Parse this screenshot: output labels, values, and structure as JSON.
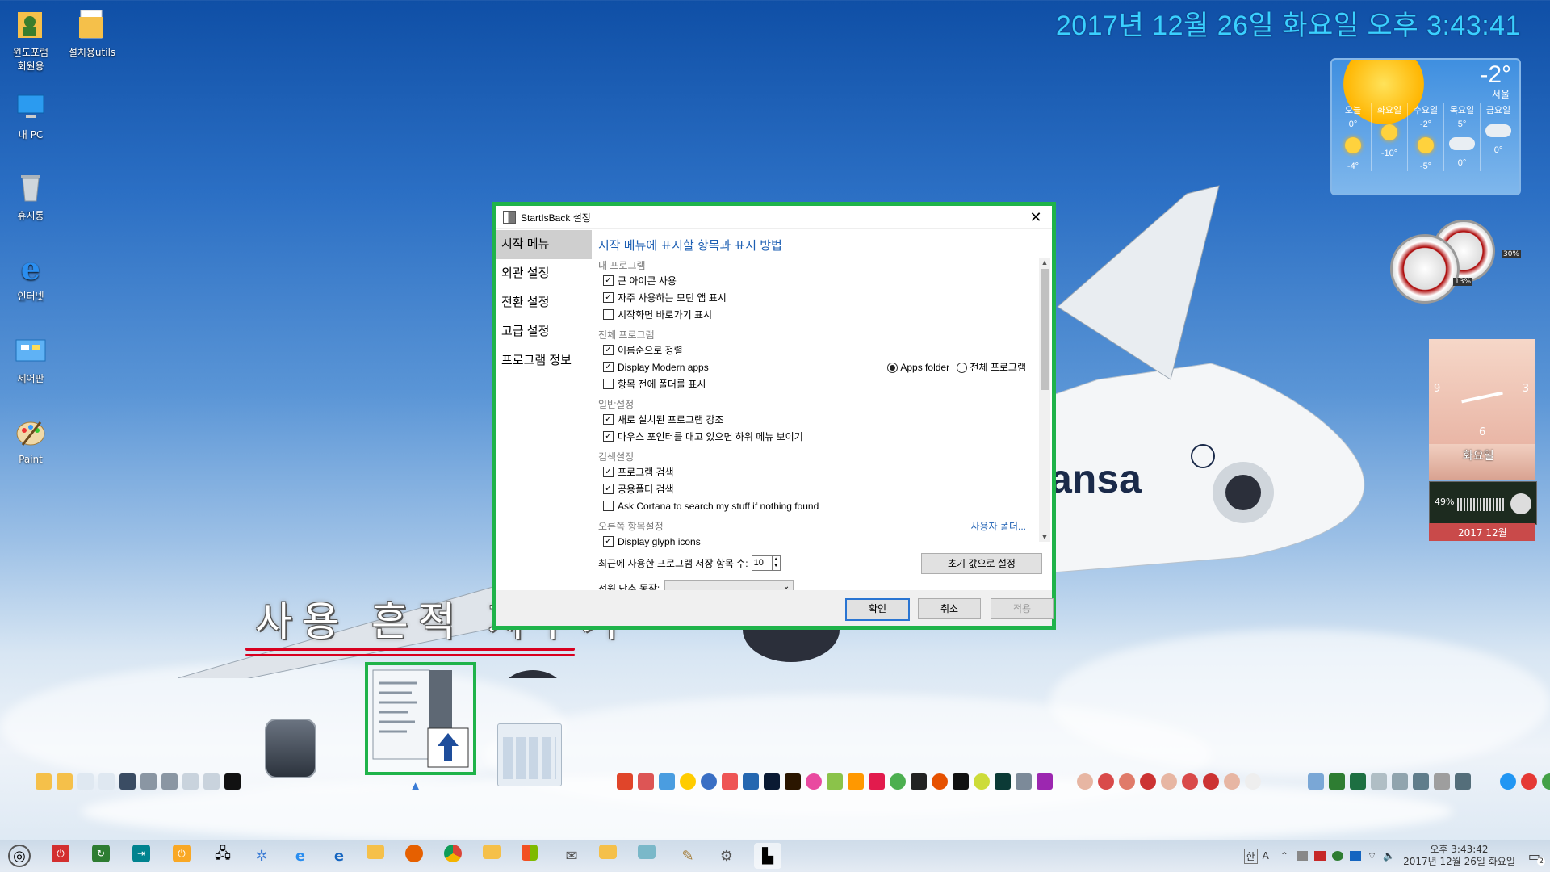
{
  "desktop": {
    "icons": [
      {
        "label1": "윈도포럼",
        "label2": "회원용"
      },
      {
        "label1": "설치용utils",
        "label2": ""
      },
      {
        "label1": "내 PC",
        "label2": ""
      },
      {
        "label1": "휴지통",
        "label2": ""
      },
      {
        "label1": "인터넷",
        "label2": ""
      },
      {
        "label1": "제어판",
        "label2": ""
      },
      {
        "label1": "Paint",
        "label2": ""
      }
    ],
    "clock_text": "2017년 12월 26일 화요일 오후 3:43:41",
    "caption": "사용 흔적 지우기"
  },
  "weather": {
    "temp": "-2°",
    "city": "서울",
    "days": [
      {
        "day": "오늘",
        "hi": "0°",
        "lo": "-4°",
        "icon": "sun"
      },
      {
        "day": "화요일",
        "hi": "",
        "lo": "-10°",
        "icon": "sun"
      },
      {
        "day": "수요일",
        "hi": "-2°",
        "lo": "-5°",
        "icon": "sun"
      },
      {
        "day": "목요일",
        "hi": "5°",
        "lo": "0°",
        "icon": "cloud"
      },
      {
        "day": "금요일",
        "hi": "",
        "lo": "0°",
        "icon": "cloud"
      }
    ]
  },
  "gadgets": {
    "cpu": "13%",
    "mem": "30%",
    "calendar_day": "화요일",
    "volume": "49%",
    "date_small": "2017 12월",
    "clock_digits": [
      "9",
      "3",
      "6"
    ]
  },
  "dialog": {
    "title": "StartIsBack 설정",
    "sidebar": [
      "시작 메뉴",
      "외관 설정",
      "전환 설정",
      "고급 설정",
      "프로그램 정보"
    ],
    "heading": "시작 메뉴에 표시할 항목과 표시 방법",
    "groups": {
      "my_programs": "내 프로그램",
      "all_programs": "전체 프로그램",
      "general": "일반설정",
      "search": "검색설정",
      "right": "오른쪽 항목설정"
    },
    "items": {
      "large_icons": {
        "label": "큰 아이콘 사용",
        "checked": true
      },
      "frequent_modern": {
        "label": "자주 사용하는 모던 앱 표시",
        "checked": true
      },
      "start_shortcuts": {
        "label": "시작화면 바로가기 표시",
        "checked": false
      },
      "sort_by_name": {
        "label": "이름순으로 정렬",
        "checked": true
      },
      "display_modern": {
        "label": "Display Modern apps",
        "checked": true
      },
      "folders_first": {
        "label": "항목 전에 폴더를 표시",
        "checked": false
      },
      "highlight_new": {
        "label": "새로 설치된 프로그램 강조",
        "checked": true
      },
      "hover_submenu": {
        "label": "마우스 포인터를 대고 있으면 하위 메뉴 보이기",
        "checked": true
      },
      "search_programs": {
        "label": "프로그램 검색",
        "checked": true
      },
      "search_public": {
        "label": "공용폴더 검색",
        "checked": true
      },
      "ask_cortana": {
        "label": "Ask Cortana to search my stuff if nothing found",
        "checked": false
      },
      "glyph_icons": {
        "label": "Display glyph icons",
        "checked": true
      }
    },
    "radio_apps_folder": "Apps folder",
    "radio_all_programs": "전체 프로그램",
    "custom_folder_link": "사용자 폴더...",
    "recent_label": "최근에 사용한 프로그램 저장 항목 수:",
    "recent_value": "10",
    "reset_button": "초기 값으로 설정",
    "power_label": "전원 단추 동작:",
    "power_value": "",
    "ok": "확인",
    "cancel": "취소",
    "apply": "적용",
    "close_glyph": "✕"
  },
  "taskbar": {
    "ime1": "한",
    "ime2": "A",
    "time": "오후 3:43:42",
    "date": "2017년 12월 26일 화요일",
    "notify_count": "2"
  },
  "colors": {
    "highlight": "#1fb34a",
    "heading": "#1d5fb3",
    "clock": "#3ad0ff",
    "underline": "#d8001f"
  }
}
